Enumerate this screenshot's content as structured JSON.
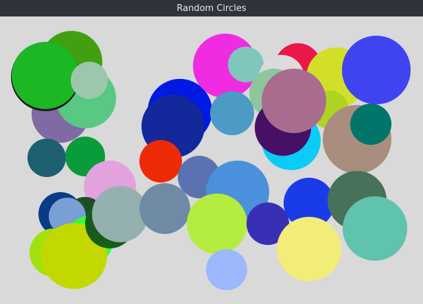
{
  "window": {
    "title": "Random Circles"
  },
  "circles": [
    {
      "color": "#41a010"
    },
    {
      "color": "#7f6aa3"
    },
    {
      "color": "#58c882"
    },
    {
      "color": "#1a1a1a"
    },
    {
      "color": "#1db625"
    },
    {
      "color": "#9cc7ab"
    },
    {
      "color": "#1e606f"
    },
    {
      "color": "#0a9b3a"
    },
    {
      "color": "#e3a2dd"
    },
    {
      "color": "#0054e0"
    },
    {
      "color": "#0019e4"
    },
    {
      "color": "#12289b"
    },
    {
      "color": "#ec2b06"
    },
    {
      "color": "#f02ce2"
    },
    {
      "color": "#4b9bc6"
    },
    {
      "color": "#7fc6bc"
    },
    {
      "color": "#eb1748"
    },
    {
      "color": "#dcdada"
    },
    {
      "color": "#8ec69c"
    },
    {
      "color": "#0bcbf9"
    },
    {
      "color": "#451066"
    },
    {
      "color": "#d2df28"
    },
    {
      "color": "#aed324"
    },
    {
      "color": "#a98d7f"
    },
    {
      "color": "#01756a"
    },
    {
      "color": "#4043f0"
    },
    {
      "color": "#a96c8e"
    },
    {
      "color": "#0a3a88"
    },
    {
      "color": "#1a4f26"
    },
    {
      "color": "#78a0d4"
    },
    {
      "color": "#a3e10e"
    },
    {
      "color": "#33ff33"
    },
    {
      "color": "#c3d801"
    },
    {
      "color": "#165d1b"
    },
    {
      "color": "#95b0b0"
    },
    {
      "color": "#5b72b2"
    },
    {
      "color": "#4b90dc"
    },
    {
      "color": "#6e8aa5"
    },
    {
      "color": "#b4ec3f"
    },
    {
      "color": "#3730b4"
    },
    {
      "color": "#1a3be8"
    },
    {
      "color": "#47715a"
    },
    {
      "color": "#5fc3ad"
    },
    {
      "color": "#f2ed79"
    },
    {
      "color": "#9cb8fd"
    }
  ]
}
